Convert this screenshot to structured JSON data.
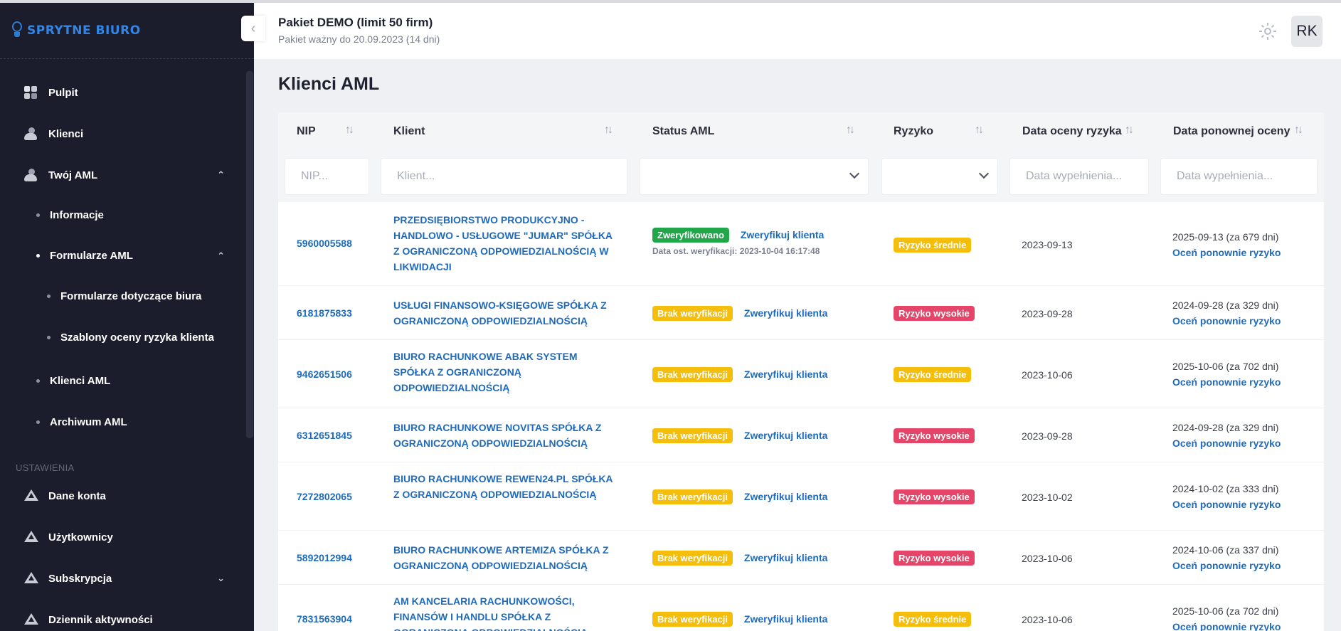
{
  "sidebar": {
    "logo_text": "SPRYTNE BIURO",
    "items": [
      {
        "label": "Pulpit",
        "icon": "dashboard-grid-icon"
      },
      {
        "label": "Klienci",
        "icon": "users-icon"
      },
      {
        "label": "Twój AML",
        "icon": "users-icon",
        "expanded": true
      }
    ],
    "aml_sub": {
      "informacje": "Informacje",
      "formularze": "Formularze AML",
      "formularze_biura": "Formularze dotyczące biura",
      "szablony": "Szablony oceny ryzyka klienta",
      "klienci_aml": "Klienci AML",
      "archiwum": "Archiwum AML"
    },
    "section_settings": "USTAWIENIA",
    "settings_items": [
      {
        "label": "Dane konta",
        "icon": "triangle-icon"
      },
      {
        "label": "Użytkownicy",
        "icon": "triangle-icon"
      },
      {
        "label": "Subskrypcja",
        "icon": "triangle-icon"
      },
      {
        "label": "Dziennik aktywności",
        "icon": "triangle-icon"
      }
    ]
  },
  "header": {
    "package_title": "Pakiet DEMO (limit 50 firm)",
    "package_subtitle": "Pakiet ważny do 20.09.2023 (14 dni)",
    "avatar_initials": "RK"
  },
  "page": {
    "title": "Klienci AML"
  },
  "table": {
    "columns": {
      "nip": "NIP",
      "client": "Klient",
      "status": "Status AML",
      "risk": "Ryzyko",
      "risk_date": "Data oceny ryzyka",
      "reassess_date": "Data ponownej oceny"
    },
    "filters": {
      "nip_placeholder": "NIP...",
      "client_placeholder": "Klient...",
      "date_placeholder": "Data wypełnienia...",
      "reassess_placeholder": "Data wypełnienia..."
    },
    "verify_label": "Zweryfikuj klienta",
    "reassess_label": "Oceń ponownie ryzyko",
    "rows": [
      {
        "nip": "5960005588",
        "client": "PRZEDSIĘBIORSTWO PRODUKCYJNO - HANDLOWO - USŁUGOWE \"JUMAR\" SPÓŁKA Z OGRANICZONĄ ODPOWIEDZIALNOŚCIĄ W LIKWIDACJI",
        "status": "Zweryfikowano",
        "status_color": "#21a74a",
        "verify_meta": "Data ost. weryfikacji: 2023-10-04 16:17:48",
        "risk": "Ryzyko średnie",
        "risk_color": "#f5be0b",
        "risk_date": "2023-09-13",
        "reassess": "2025-09-13 (za 679 dni)"
      },
      {
        "nip": "6181875833",
        "client": "USŁUGI FINANSOWO-KSIĘGOWE SPÓŁKA Z OGRANICZONĄ ODPOWIEDZIALNOŚCIĄ",
        "status": "Brak weryfikacji",
        "status_color": "#f5be0b",
        "verify_meta": "",
        "risk": "Ryzyko wysokie",
        "risk_color": "#e6456a",
        "risk_date": "2023-09-28",
        "reassess": "2024-09-28 (za 329 dni)"
      },
      {
        "nip": "9462651506",
        "client": "BIURO RACHUNKOWE ABAK SYSTEM SPÓŁKA Z OGRANICZONĄ ODPOWIEDZIALNOŚCIĄ",
        "status": "Brak weryfikacji",
        "status_color": "#f5be0b",
        "verify_meta": "",
        "risk": "Ryzyko średnie",
        "risk_color": "#f5be0b",
        "risk_date": "2023-10-06",
        "reassess": "2025-10-06 (za 702 dni)"
      },
      {
        "nip": "6312651845",
        "client": "BIURO RACHUNKOWE NOVITAS SPÓŁKA Z OGRANICZONĄ ODPOWIEDZIALNOŚCIĄ",
        "status": "Brak weryfikacji",
        "status_color": "#f5be0b",
        "verify_meta": "",
        "risk": "Ryzyko wysokie",
        "risk_color": "#e6456a",
        "risk_date": "2023-09-28",
        "reassess": "2024-09-28 (za 329 dni)"
      },
      {
        "nip": "7272802065",
        "client": "BIURO RACHUNKOWE REWEN24.PL SPÓŁKA Z OGRANICZONĄ ODPOWIEDZIALNOŚCIĄ",
        "status": "Brak weryfikacji",
        "status_color": "#f5be0b",
        "verify_meta": "",
        "risk": "Ryzyko wysokie",
        "risk_color": "#e6456a",
        "risk_date": "2023-10-02",
        "reassess": "2024-10-02 (za 333 dni)"
      },
      {
        "nip": "5892012994",
        "client": "BIURO RACHUNKOWE ARTEMIZA SPÓŁKA Z OGRANICZONĄ ODPOWIEDZIALNOŚCIĄ",
        "status": "Brak weryfikacji",
        "status_color": "#f5be0b",
        "verify_meta": "",
        "risk": "Ryzyko wysokie",
        "risk_color": "#e6456a",
        "risk_date": "2023-10-06",
        "reassess": "2024-10-06 (za 337 dni)"
      },
      {
        "nip": "7831563904",
        "client": "AM KANCELARIA RACHUNKOWOŚCI, FINANSÓW I HANDLU SPÓŁKA Z OGRANICZONĄ ODPOWIEDZIALNOŚCIĄ",
        "status": "Brak weryfikacji",
        "status_color": "#f5be0b",
        "verify_meta": "",
        "risk": "Ryzyko średnie",
        "risk_color": "#f5be0b",
        "risk_date": "2023-10-06",
        "reassess": "2025-10-06 (za 702 dni)"
      }
    ]
  }
}
